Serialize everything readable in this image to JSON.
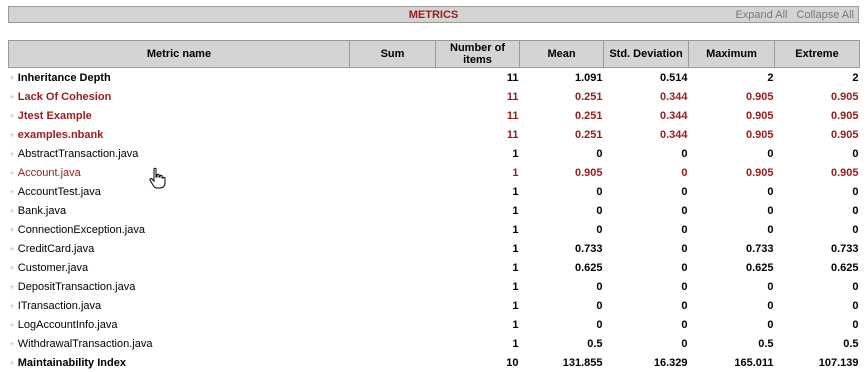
{
  "header": {
    "title": "METRICS",
    "expand_all": "Expand All",
    "collapse_all": "Collapse All"
  },
  "columns": [
    "Metric name",
    "Sum",
    "Number of items",
    "Mean",
    "Std. Deviation",
    "Maximum",
    "Extreme"
  ],
  "rows": [
    {
      "name": "Inheritance Depth",
      "level": 0,
      "group": true,
      "highlight": false,
      "sum": "",
      "items": "11",
      "mean": "1.091",
      "std": "0.514",
      "max": "2",
      "extreme": "2"
    },
    {
      "name": "Lack Of Cohesion",
      "level": 0,
      "group": true,
      "highlight": true,
      "sum": "",
      "items": "11",
      "mean": "0.251",
      "std": "0.344",
      "max": "0.905",
      "extreme": "0.905"
    },
    {
      "name": "Jtest Example",
      "level": 1,
      "group": true,
      "highlight": true,
      "sum": "",
      "items": "11",
      "mean": "0.251",
      "std": "0.344",
      "max": "0.905",
      "extreme": "0.905"
    },
    {
      "name": "examples.nbank",
      "level": 2,
      "group": true,
      "highlight": true,
      "sum": "",
      "items": "11",
      "mean": "0.251",
      "std": "0.344",
      "max": "0.905",
      "extreme": "0.905"
    },
    {
      "name": "AbstractTransaction.java",
      "level": 3,
      "group": false,
      "highlight": false,
      "sum": "",
      "items": "1",
      "mean": "0",
      "std": "0",
      "max": "0",
      "extreme": "0"
    },
    {
      "name": "Account.java",
      "level": 3,
      "group": false,
      "highlight": true,
      "sum": "",
      "items": "1",
      "mean": "0.905",
      "std": "0",
      "max": "0.905",
      "extreme": "0.905"
    },
    {
      "name": "AccountTest.java",
      "level": 3,
      "group": false,
      "highlight": false,
      "sum": "",
      "items": "1",
      "mean": "0",
      "std": "0",
      "max": "0",
      "extreme": "0"
    },
    {
      "name": "Bank.java",
      "level": 3,
      "group": false,
      "highlight": false,
      "sum": "",
      "items": "1",
      "mean": "0",
      "std": "0",
      "max": "0",
      "extreme": "0"
    },
    {
      "name": "ConnectionException.java",
      "level": 3,
      "group": false,
      "highlight": false,
      "sum": "",
      "items": "1",
      "mean": "0",
      "std": "0",
      "max": "0",
      "extreme": "0"
    },
    {
      "name": "CreditCard.java",
      "level": 3,
      "group": false,
      "highlight": false,
      "sum": "",
      "items": "1",
      "mean": "0.733",
      "std": "0",
      "max": "0.733",
      "extreme": "0.733"
    },
    {
      "name": "Customer.java",
      "level": 3,
      "group": false,
      "highlight": false,
      "sum": "",
      "items": "1",
      "mean": "0.625",
      "std": "0",
      "max": "0.625",
      "extreme": "0.625"
    },
    {
      "name": "DepositTransaction.java",
      "level": 3,
      "group": false,
      "highlight": false,
      "sum": "",
      "items": "1",
      "mean": "0",
      "std": "0",
      "max": "0",
      "extreme": "0"
    },
    {
      "name": "ITransaction.java",
      "level": 3,
      "group": false,
      "highlight": false,
      "sum": "",
      "items": "1",
      "mean": "0",
      "std": "0",
      "max": "0",
      "extreme": "0"
    },
    {
      "name": "LogAccountInfo.java",
      "level": 3,
      "group": false,
      "highlight": false,
      "sum": "",
      "items": "1",
      "mean": "0",
      "std": "0",
      "max": "0",
      "extreme": "0"
    },
    {
      "name": "WithdrawalTransaction.java",
      "level": 3,
      "group": false,
      "highlight": false,
      "sum": "",
      "items": "1",
      "mean": "0.5",
      "std": "0",
      "max": "0.5",
      "extreme": "0.5"
    },
    {
      "name": "Maintainability Index",
      "level": 0,
      "group": true,
      "highlight": false,
      "sum": "",
      "items": "10",
      "mean": "131.855",
      "std": "16.329",
      "max": "165.011",
      "extreme": "107.139"
    }
  ],
  "colors": {
    "accent": "#9b1b1b",
    "header_bg": "#d4d4d4",
    "border": "#9a9a9a"
  },
  "icons": {
    "expander": "+",
    "cursor": "hand-pointer-icon"
  }
}
